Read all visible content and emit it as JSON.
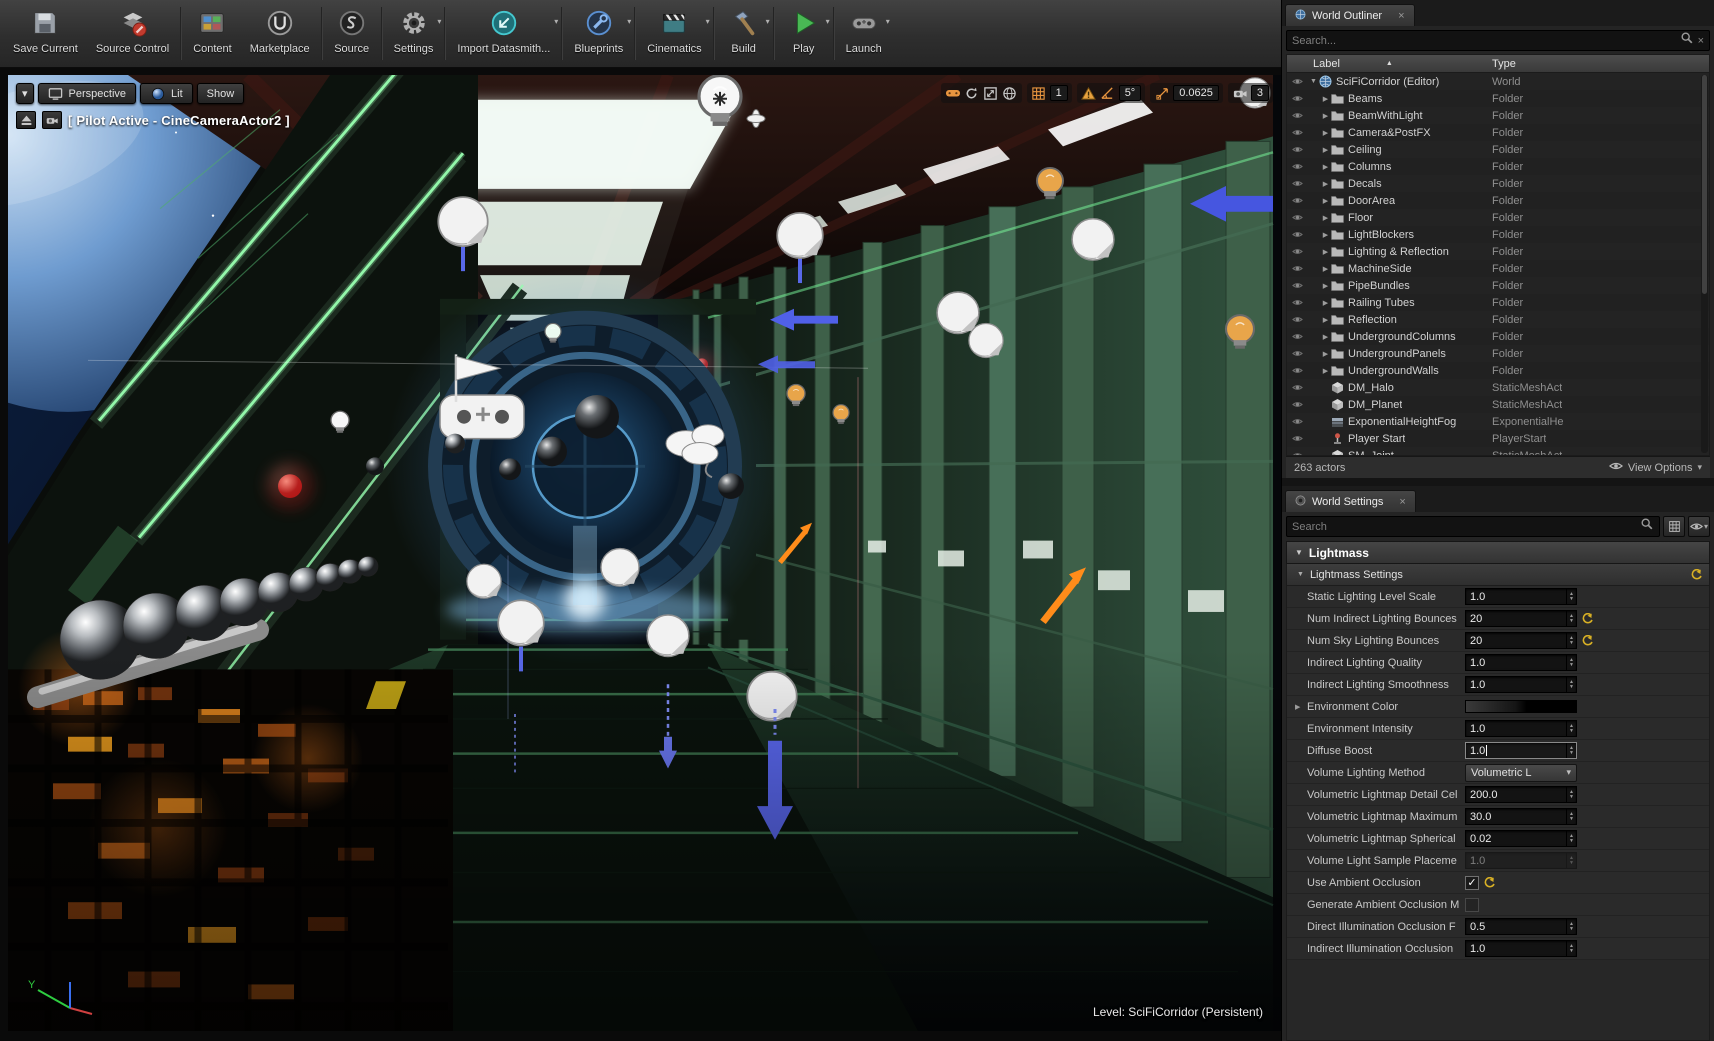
{
  "colors": {
    "accent_orange": "#e8953f",
    "selection_blue": "#5a68f0",
    "neon_green": "#8cffa3",
    "portal_blue": "#58a0cc",
    "reset_yellow": "#d8b025"
  },
  "icons": {
    "close": "×",
    "caret_down": "▾",
    "sort_asc": "▲",
    "arrow_right": "▶",
    "arrow_down": "▼",
    "check": "✓"
  },
  "toolbar": {
    "items": [
      {
        "label": "Save Current"
      },
      {
        "label": "Source Control"
      },
      {
        "label": "Content"
      },
      {
        "label": "Marketplace"
      },
      {
        "label": "Source"
      },
      {
        "label": "Settings"
      },
      {
        "label": "Import Datasmith..."
      },
      {
        "label": "Blueprints"
      },
      {
        "label": "Cinematics"
      },
      {
        "label": "Build"
      },
      {
        "label": "Play"
      },
      {
        "label": "Launch"
      }
    ]
  },
  "viewport": {
    "perspective": "Perspective",
    "lit": "Lit",
    "show": "Show",
    "pilot_text": "[ Pilot Active - CineCameraActor2 ]",
    "location_snap": "1",
    "rotation_snap": "5°",
    "scale_snap": "0.0625",
    "camera_speed": "3",
    "level_text": "Level:  SciFiCorridor (Persistent)",
    "axis_label_y": "Y"
  },
  "world_outliner": {
    "title": "World Outliner",
    "search_placeholder": "Search...",
    "label_column": "Label",
    "type_column": "Type",
    "actor_count": "263 actors",
    "view_options": "View Options",
    "rows": [
      {
        "label": "SciFiCorridor (Editor)",
        "type": "World",
        "icon": "world",
        "level": 0,
        "expanded": true
      },
      {
        "label": "Beams",
        "type": "Folder",
        "icon": "folder",
        "level": 1
      },
      {
        "label": "BeamWithLight",
        "type": "Folder",
        "icon": "folder",
        "level": 1
      },
      {
        "label": "Camera&PostFX",
        "type": "Folder",
        "icon": "folder",
        "level": 1
      },
      {
        "label": "Ceiling",
        "type": "Folder",
        "icon": "folder",
        "level": 1
      },
      {
        "label": "Columns",
        "type": "Folder",
        "icon": "folder",
        "level": 1
      },
      {
        "label": "Decals",
        "type": "Folder",
        "icon": "folder",
        "level": 1
      },
      {
        "label": "DoorArea",
        "type": "Folder",
        "icon": "folder",
        "level": 1
      },
      {
        "label": "Floor",
        "type": "Folder",
        "icon": "folder",
        "level": 1
      },
      {
        "label": "LightBlockers",
        "type": "Folder",
        "icon": "folder",
        "level": 1
      },
      {
        "label": "Lighting & Reflection",
        "type": "Folder",
        "icon": "folder",
        "level": 1
      },
      {
        "label": "MachineSide",
        "type": "Folder",
        "icon": "folder",
        "level": 1
      },
      {
        "label": "PipeBundles",
        "type": "Folder",
        "icon": "folder",
        "level": 1
      },
      {
        "label": "Railing Tubes",
        "type": "Folder",
        "icon": "folder",
        "level": 1
      },
      {
        "label": "Reflection",
        "type": "Folder",
        "icon": "folder",
        "level": 1
      },
      {
        "label": "UndergroundColumns",
        "type": "Folder",
        "icon": "folder",
        "level": 1
      },
      {
        "label": "UndergroundPanels",
        "type": "Folder",
        "icon": "folder",
        "level": 1
      },
      {
        "label": "UndergroundWalls",
        "type": "Folder",
        "icon": "folder",
        "level": 1
      },
      {
        "label": "DM_Halo",
        "type": "StaticMeshAct",
        "icon": "mesh",
        "level": 1
      },
      {
        "label": "DM_Planet",
        "type": "StaticMeshAct",
        "icon": "mesh",
        "level": 1
      },
      {
        "label": "ExponentialHeightFog",
        "type": "ExponentialHe",
        "icon": "fog",
        "level": 1
      },
      {
        "label": "Player Start",
        "type": "PlayerStart",
        "icon": "player",
        "level": 1
      },
      {
        "label": "SM_Joint",
        "type": "StaticMeshAct",
        "icon": "mesh",
        "level": 1
      }
    ]
  },
  "world_settings": {
    "title": "World Settings",
    "search_placeholder": "Search",
    "section": "Lightmass",
    "rows": [
      {
        "kind": "subheader",
        "label": "Lightmass Settings",
        "reset": true
      },
      {
        "label": "Static Lighting Level Scale",
        "value": "1.0",
        "control": "spin"
      },
      {
        "label": "Num Indirect Lighting Bounces",
        "value": "20",
        "control": "spin",
        "reset": true
      },
      {
        "label": "Num Sky Lighting Bounces",
        "value": "20",
        "control": "spin",
        "reset": true
      },
      {
        "label": "Indirect Lighting Quality",
        "value": "1.0",
        "control": "spin"
      },
      {
        "label": "Indirect Lighting Smoothness",
        "value": "1.0",
        "control": "spin"
      },
      {
        "label": "Environment Color",
        "value": "#000000",
        "control": "color",
        "expand": true
      },
      {
        "label": "Environment Intensity",
        "value": "1.0",
        "control": "spin"
      },
      {
        "label": "Diffuse Boost",
        "value": "1.0",
        "control": "spin",
        "editing": true
      },
      {
        "label": "Volume Lighting Method",
        "value": "Volumetric L",
        "control": "dropdown"
      },
      {
        "label": "Volumetric Lightmap Detail Cel",
        "value": "200.0",
        "control": "spin"
      },
      {
        "label": "Volumetric Lightmap Maximum",
        "value": "30.0",
        "control": "spin"
      },
      {
        "label": "Volumetric Lightmap Spherical",
        "value": "0.02",
        "control": "spin"
      },
      {
        "label": "Volume Light Sample Placeme",
        "value": "1.0",
        "control": "spin",
        "disabled": true
      },
      {
        "label": "Use Ambient Occlusion",
        "control": "checkbox",
        "checked": true,
        "reset": true
      },
      {
        "label": "Generate Ambient Occlusion M",
        "control": "checkbox",
        "checked": false
      },
      {
        "label": "Direct Illumination Occlusion F",
        "value": "0.5",
        "control": "spin"
      },
      {
        "label": "Indirect Illumination Occlusion",
        "value": "1.0",
        "control": "spin"
      }
    ]
  }
}
